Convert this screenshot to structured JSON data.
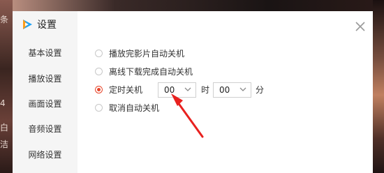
{
  "background": {
    "glyphs": [
      "条",
      "4",
      "白",
      "洁"
    ]
  },
  "dialog": {
    "title": "设置",
    "close_icon": "close-icon",
    "brand_icon": "tencent-video-logo-icon",
    "sidebar": {
      "items": [
        {
          "label": "基本设置"
        },
        {
          "label": "播放设置"
        },
        {
          "label": "画面设置"
        },
        {
          "label": "音频设置"
        },
        {
          "label": "网络设置"
        }
      ]
    },
    "shutdown": {
      "options": [
        {
          "label": "播放完影片自动关机",
          "checked": false
        },
        {
          "label": "离线下载完成自动关机",
          "checked": false
        },
        {
          "label": "定时关机",
          "checked": true
        },
        {
          "label": "取消自动关机",
          "checked": false
        }
      ],
      "hour": {
        "value": "00",
        "unit": "时"
      },
      "minute": {
        "value": "00",
        "unit": "分"
      }
    },
    "colors": {
      "accent": "#e8452a",
      "annotation_arrow": "#e8211f"
    }
  }
}
